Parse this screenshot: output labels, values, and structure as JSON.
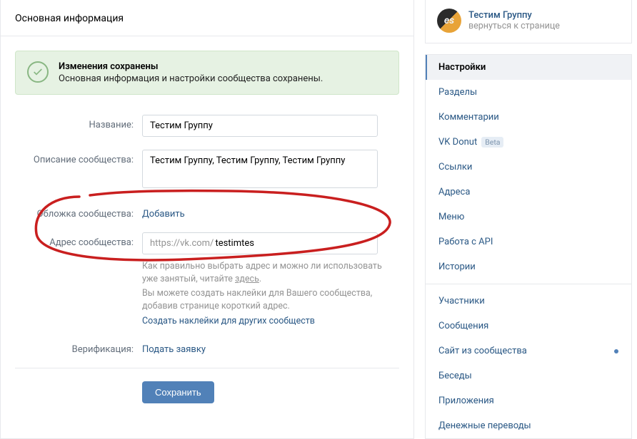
{
  "header": {
    "title": "Основная информация"
  },
  "success": {
    "title": "Изменения сохранены",
    "message": "Основная информация и настройки сообщества сохранены."
  },
  "form": {
    "name_label": "Название:",
    "name_value": "Тестим Группу",
    "desc_label": "Описание сообщества:",
    "desc_value": "Тестим Группу, Тестим Группу, Тестим Группу",
    "cover_label": "Обложка сообщества:",
    "cover_action": "Добавить",
    "addr_label": "Адрес сообщества:",
    "addr_prefix": "https://vk.com/",
    "addr_value": "testimtes",
    "hint1_a": "Как правильно выбрать адрес и можно ли использовать уже занятый, читайте ",
    "hint1_link": "здесь",
    "hint1_b": ".",
    "hint2": "Вы можете создать наклейки для Вашего сообщества, добавив странице короткий адрес.",
    "hint3_link": "Создать наклейки для других сообществ",
    "verify_label": "Верификация:",
    "verify_action": "Подать заявку",
    "save_btn": "Сохранить"
  },
  "side": {
    "group_name": "Тестим Группу",
    "back_text": "вернуться к странице",
    "avatar_text": "es",
    "menu": [
      {
        "label": "Настройки",
        "active": true
      },
      {
        "label": "Разделы"
      },
      {
        "label": "Комментарии"
      },
      {
        "label": "VK Donut",
        "badge": "Beta"
      },
      {
        "label": "Ссылки"
      },
      {
        "label": "Адреса"
      },
      {
        "label": "Меню"
      },
      {
        "label": "Работа с API"
      },
      {
        "label": "Истории"
      },
      {
        "sep": true
      },
      {
        "label": "Участники"
      },
      {
        "label": "Сообщения"
      },
      {
        "label": "Сайт из сообщества",
        "dot": true
      },
      {
        "label": "Беседы"
      },
      {
        "label": "Приложения"
      },
      {
        "label": "Денежные переводы"
      }
    ]
  }
}
